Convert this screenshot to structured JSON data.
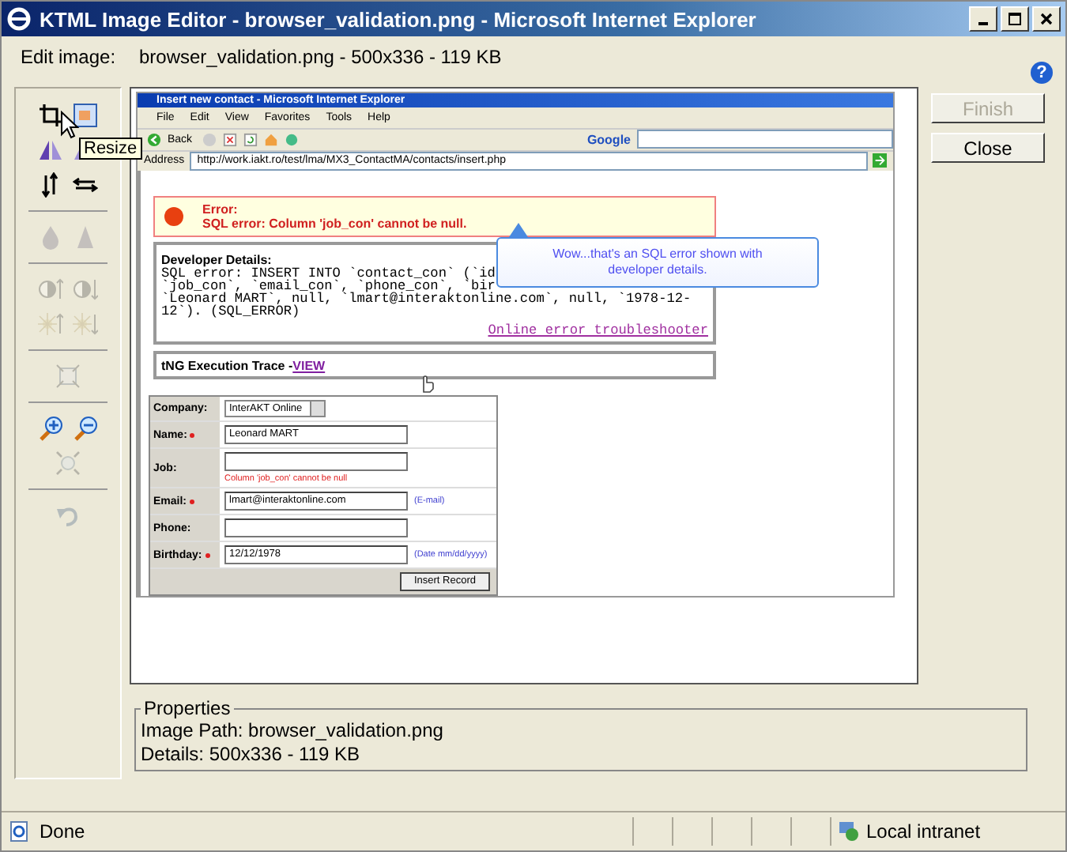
{
  "window": {
    "title": "KTML Image Editor - browser_validation.png - Microsoft Internet Explorer"
  },
  "edit_image": {
    "label": "Edit image:",
    "value": "browser_validation.png - 500x336 - 119 KB"
  },
  "help": "?",
  "tool_groups": [
    [
      [
        {
          "kind": "crop",
          "disabled": false
        },
        {
          "kind": "resize",
          "disabled": false
        }
      ],
      [
        {
          "kind": "flip-h",
          "disabled": false
        },
        {
          "kind": "flip-v",
          "disabled": false
        }
      ],
      [
        {
          "kind": "swap-v",
          "disabled": false
        },
        {
          "kind": "swap-h",
          "disabled": false
        }
      ]
    ],
    [
      [
        {
          "kind": "blur",
          "disabled": true
        },
        {
          "kind": "sharpen",
          "disabled": true
        }
      ]
    ],
    [
      [
        {
          "kind": "contrast-up",
          "disabled": true
        },
        {
          "kind": "contrast-down",
          "disabled": true
        }
      ],
      [
        {
          "kind": "bright-up",
          "disabled": true
        },
        {
          "kind": "bright-down",
          "disabled": true
        }
      ]
    ],
    [
      [
        {
          "kind": "fit-crop",
          "disabled": true
        }
      ]
    ],
    [
      [
        {
          "kind": "zoom-in",
          "disabled": false
        },
        {
          "kind": "zoom-out",
          "disabled": false
        }
      ],
      [
        {
          "kind": "actual",
          "disabled": true
        }
      ]
    ],
    [
      [
        {
          "kind": "undo",
          "disabled": true
        }
      ]
    ]
  ],
  "tooltip": "Resize",
  "buttons": [
    {
      "label": "Finish",
      "disabled": true
    },
    {
      "label": "Close",
      "disabled": false
    }
  ],
  "screenshot": {
    "title": "Insert new contact - Microsoft Internet Explorer",
    "menu": [
      "File",
      "Edit",
      "View",
      "Favorites",
      "Tools",
      "Help"
    ],
    "back": "Back",
    "search_brand": "Google",
    "address_label": "Address",
    "address": "http://work.iakt.ro/test/lma/MX3_ContactMA/contacts/insert.php",
    "error_title": "Error:",
    "error_message": "SQL error: Column 'job_con' cannot be null.",
    "dev_title": "Developer Details:",
    "dev_lines": [
      "SQL error: INSERT INTO `contact_con` (`id",
      "`job_con`, `email_con`, `phone_con`, `bir",
      "`Leonard MART`, null, `lmart@interaktonline.com`, null, `1978-12-",
      "12`). (SQL_ERROR)"
    ],
    "troubleshooter": "Online error troubleshooter",
    "trace_label": "tNG Execution Trace - ",
    "trace_link": "VIEW",
    "balloon": "Wow...that's an SQL error shown with developer details.",
    "form": [
      {
        "label": "Company:",
        "required": false,
        "kind": "select",
        "value": "InterAKT Online"
      },
      {
        "label": "Name:",
        "required": true,
        "kind": "text",
        "value": "Leonard MART"
      },
      {
        "label": "Job:",
        "required": false,
        "kind": "text",
        "error": "Column 'job_con' cannot be null"
      },
      {
        "label": "Email:",
        "required": true,
        "kind": "text",
        "value": "lmart@interaktonline.com",
        "hint": "(E-mail)"
      },
      {
        "label": "Phone:",
        "required": false,
        "kind": "text"
      },
      {
        "label": "Birthday:",
        "required": true,
        "kind": "text",
        "value": "12/12/1978",
        "hint": "(Date mm/dd/yyyy)"
      }
    ],
    "submit": "Insert Record"
  },
  "properties": {
    "legend": "Properties",
    "lines": [
      "Image Path: browser_validation.png",
      "Details: 500x336 - 119 KB"
    ]
  },
  "status_bar": {
    "text": "Done",
    "zone": "Local intranet"
  }
}
